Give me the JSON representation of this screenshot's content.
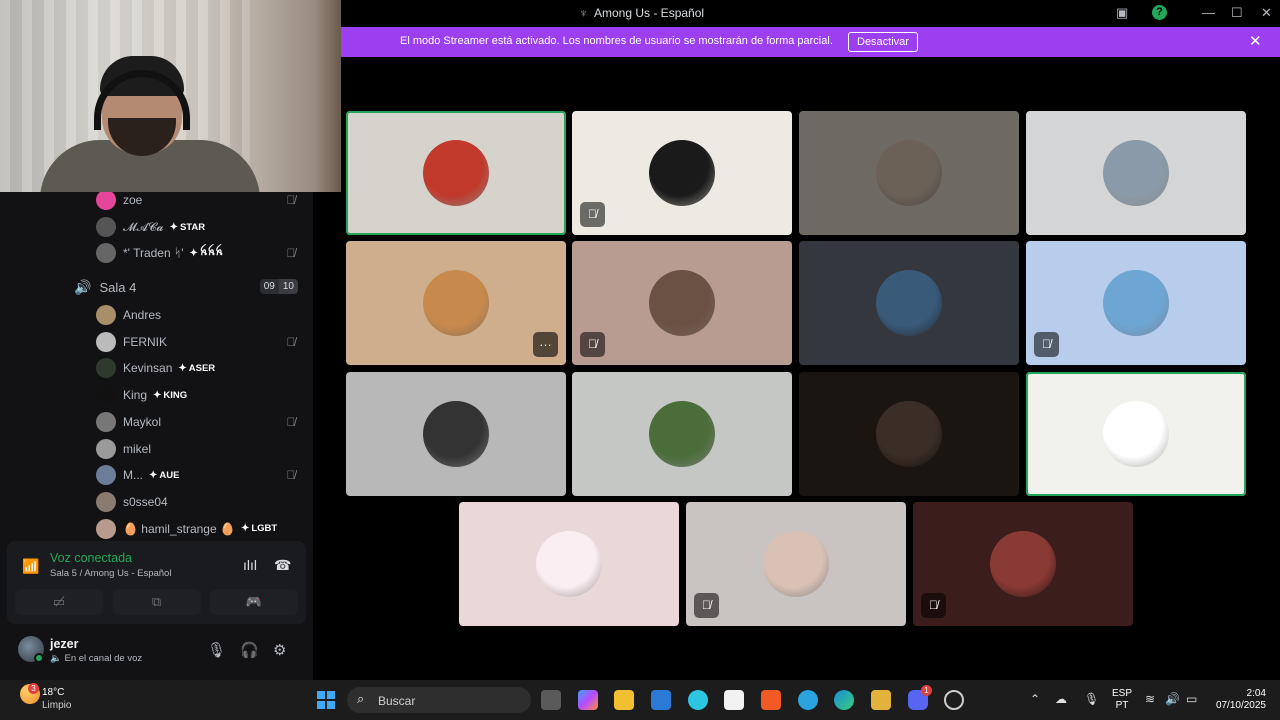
{
  "window": {
    "title": "Among Us - Español"
  },
  "banner": {
    "message": "El modo Streamer está activado. Los nombres de usuario se mostrarán de forma parcial.",
    "action": "Desactivar"
  },
  "channel_users_top": [
    {
      "name": "zoe",
      "badge": "",
      "muted": true,
      "avatar_color": "#e5469a"
    },
    {
      "name": "𝓜𝓐𝓒𝓪",
      "badge": "STAR",
      "muted": false,
      "avatar_color": "#555555"
    },
    {
      "name": "*' Traden ᛋ'",
      "badge": "ꫝꫝꫝ",
      "muted": true,
      "avatar_color": "#666666"
    }
  ],
  "sala": {
    "name": "Sala 4",
    "count_a": "09",
    "count_b": "10"
  },
  "sala_users": [
    {
      "name": "Andres",
      "badge": "",
      "muted": false,
      "avatar_color": "#a88f6a"
    },
    {
      "name": "FERNIK",
      "badge": "",
      "muted": true,
      "avatar_color": "#bbbbbb"
    },
    {
      "name": "Kevinsan",
      "badge": "ASER",
      "muted": false,
      "avatar_color": "#2f3a2f"
    },
    {
      "name": "King",
      "badge": "KING",
      "muted": false,
      "avatar_color": "#111111"
    },
    {
      "name": "Maykol",
      "badge": "",
      "muted": true,
      "avatar_color": "#777777"
    },
    {
      "name": "mikel",
      "badge": "",
      "muted": false,
      "avatar_color": "#9a9a9a"
    },
    {
      "name": "M...",
      "badge": "AUE",
      "muted": true,
      "avatar_color": "#6b7d99"
    },
    {
      "name": "s0sse04",
      "badge": "",
      "muted": false,
      "avatar_color": "#8a7b70"
    },
    {
      "name": "🥚 hamil_strange 🥚",
      "badge": "LGBT",
      "muted": false,
      "avatar_color": "#b99b8e"
    }
  ],
  "voice": {
    "status": "Voz conectada",
    "location": "Sala 5 / Among Us - Español"
  },
  "user": {
    "name": "jezer",
    "status": "En el canal de voz"
  },
  "tiles": [
    {
      "bg": "#d6d3cc",
      "avatar": "#c0392b",
      "muted": false,
      "speaking": true,
      "more": false
    },
    {
      "bg": "#eceae2",
      "avatar": "#1a1a1a",
      "muted": true,
      "speaking": false,
      "more": false
    },
    {
      "bg": "#6d6a64",
      "avatar": "#6b6157",
      "muted": false,
      "speaking": false,
      "more": false
    },
    {
      "bg": "#d4d5d7",
      "avatar": "#8a9aa8",
      "muted": false,
      "speaking": false,
      "more": false
    },
    {
      "bg": "#cfae8e",
      "avatar": "#c88a4c",
      "muted": false,
      "speaking": false,
      "more": true
    },
    {
      "bg": "#b89b91",
      "avatar": "#6a5144",
      "muted": true,
      "speaking": false,
      "more": false
    },
    {
      "bg": "#34373d",
      "avatar": "#3a5a7a",
      "muted": false,
      "speaking": false,
      "more": false
    },
    {
      "bg": "#b7cdeb",
      "avatar": "#6ea6d3",
      "muted": true,
      "speaking": false,
      "more": false
    },
    {
      "bg": "#b8b8b8",
      "avatar": "#333333",
      "muted": false,
      "speaking": false,
      "more": false
    },
    {
      "bg": "#c5c7c4",
      "avatar": "#4b6d3a",
      "muted": false,
      "speaking": false,
      "more": false
    },
    {
      "bg": "#1b1512",
      "avatar": "#3b2e26",
      "muted": false,
      "speaking": false,
      "more": false
    },
    {
      "bg": "#f1f1ee",
      "avatar": "#ffffff",
      "muted": false,
      "speaking": true,
      "more": false
    },
    {
      "bg": "#e9d7d9",
      "avatar": "#fbeef2",
      "muted": false,
      "speaking": false,
      "more": false
    },
    {
      "bg": "#c9c3c2",
      "avatar": "#d9c2b5",
      "muted": true,
      "speaking": false,
      "more": false
    },
    {
      "bg": "#3b1e1c",
      "avatar": "#8a3a34",
      "muted": true,
      "speaking": false,
      "more": false
    }
  ],
  "taskbar": {
    "temperature": "18°C",
    "condition": "Limpio",
    "weather_badge": "3",
    "search_placeholder": "Buscar",
    "lang_1": "ESP",
    "lang_2": "PT",
    "time": "2:04",
    "date": "07/10/2025",
    "discord_badge": "1"
  },
  "colors": {
    "accent_green": "#23a55a",
    "banner_purple": "#9c3ff1"
  }
}
